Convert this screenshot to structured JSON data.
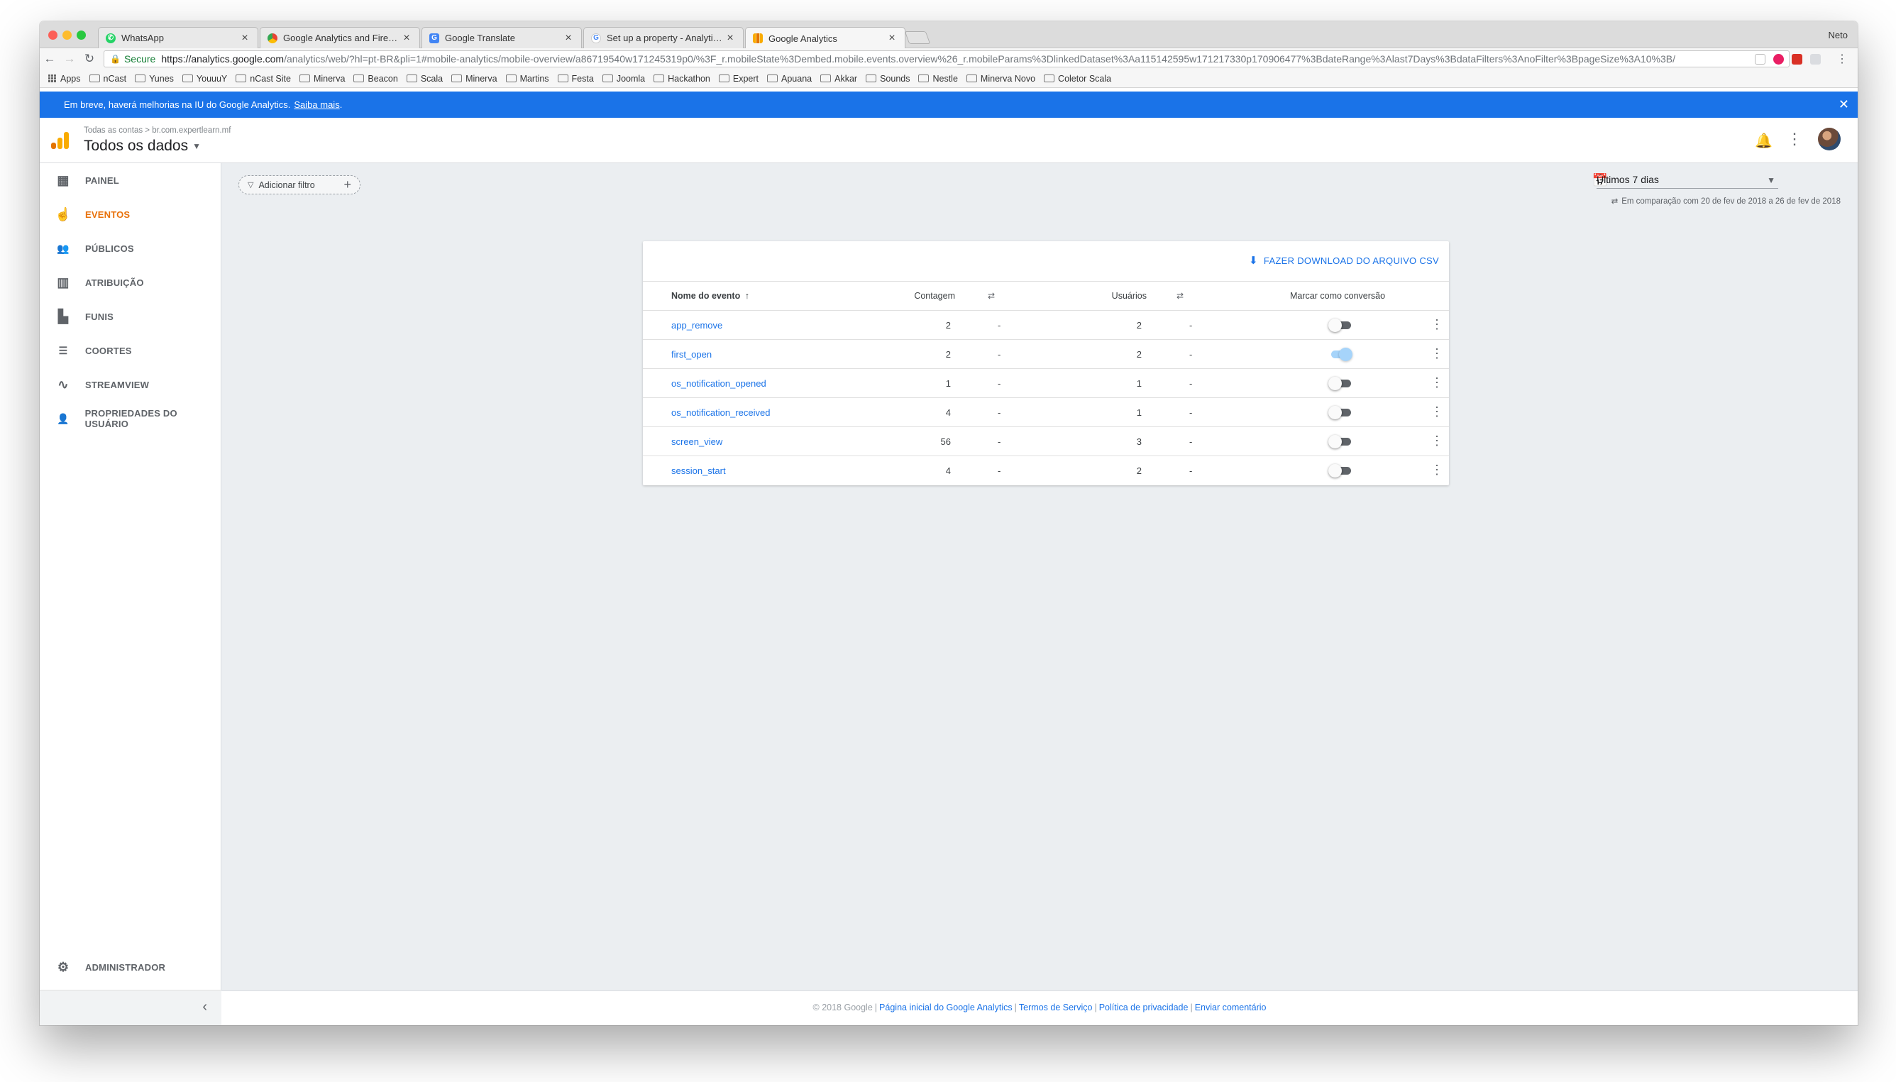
{
  "browser": {
    "profile_name": "Neto",
    "tabs": [
      {
        "label": "WhatsApp",
        "icon": "whatsapp-icon",
        "color": "#25d366"
      },
      {
        "label": "Google Analytics and Firebase",
        "icon": "chrome-icon",
        "color": "#4285f4"
      },
      {
        "label": "Google Translate",
        "icon": "translate-icon",
        "color": "#4285f4"
      },
      {
        "label": "Set up a property - Analytics H",
        "icon": "google-icon",
        "color": "#ea4335"
      },
      {
        "label": "Google Analytics",
        "icon": "analytics-icon",
        "color": "#f9ab00"
      }
    ],
    "secure_label": "Secure",
    "url_host": "https://analytics.google.com",
    "url_path": "/analytics/web/?hl=pt-BR&pli=1#mobile-analytics/mobile-overview/a86719540w171245319p0/%3F_r.mobileState%3Dembed.mobile.events.overview%26_r.mobileParams%3DlinkedDataset%3Aa115142595w171217330p170906477%3BdateRange%3Alast7Days%3BdataFilters%3AnoFilter%3BpageSize%3A10%3B/",
    "bookmarks": [
      "Apps",
      "nCast",
      "Yunes",
      "YouuuY",
      "nCast Site",
      "Minerva",
      "Beacon",
      "Scala",
      "Minerva",
      "Martins",
      "Festa",
      "Joomla",
      "Hackathon",
      "Expert",
      "Apuana",
      "Akkar",
      "Sounds",
      "Nestle",
      "Minerva Novo",
      "Coletor Scala"
    ]
  },
  "banner": {
    "text": "Em breve, haverá melhorias na IU do Google Analytics.",
    "link": "Saiba mais",
    "period": "."
  },
  "header": {
    "breadcrumb": "Todas as contas  >  br.com.expertlearn.mf",
    "title": "Todos os dados"
  },
  "sidebar": {
    "items": [
      {
        "label": "PAINEL",
        "icon": "dashboard-icon"
      },
      {
        "label": "EVENTOS",
        "icon": "touch-icon",
        "active": true
      },
      {
        "label": "PÚBLICOS",
        "icon": "audiences-icon"
      },
      {
        "label": "ATRIBUIÇÃO",
        "icon": "attribution-icon"
      },
      {
        "label": "FUNIS",
        "icon": "funnels-icon"
      },
      {
        "label": "COORTES",
        "icon": "cohorts-icon"
      },
      {
        "label": "STREAMVIEW",
        "icon": "streamview-icon"
      },
      {
        "label": "PROPRIEDADES DO USUÁRIO",
        "icon": "user-properties-icon"
      }
    ],
    "admin_label": "ADMINISTRADOR"
  },
  "main": {
    "filter_label": "Adicionar filtro",
    "date_range": "Últimos 7 dias",
    "comparison": "Em comparação com 20 de fev de 2018 a 26 de fev de 2018"
  },
  "events": {
    "download_label": "FAZER DOWNLOAD DO ARQUIVO CSV",
    "columns": {
      "name": "Nome do evento",
      "count": "Contagem",
      "users": "Usuários",
      "conversion": "Marcar como conversão"
    },
    "rows": [
      {
        "name": "app_remove",
        "count": "2",
        "count_change": "-",
        "users": "2",
        "users_change": "-",
        "conversion": false
      },
      {
        "name": "first_open",
        "count": "2",
        "count_change": "-",
        "users": "2",
        "users_change": "-",
        "conversion": true
      },
      {
        "name": "os_notification_opened",
        "count": "1",
        "count_change": "-",
        "users": "1",
        "users_change": "-",
        "conversion": false
      },
      {
        "name": "os_notification_received",
        "count": "4",
        "count_change": "-",
        "users": "1",
        "users_change": "-",
        "conversion": false
      },
      {
        "name": "screen_view",
        "count": "56",
        "count_change": "-",
        "users": "3",
        "users_change": "-",
        "conversion": false
      },
      {
        "name": "session_start",
        "count": "4",
        "count_change": "-",
        "users": "2",
        "users_change": "-",
        "conversion": false
      }
    ]
  },
  "footer": {
    "copyright": "© 2018 Google",
    "links": [
      "Página inicial do Google Analytics",
      "Termos de Serviço",
      "Política de privacidade",
      "Enviar comentário"
    ]
  }
}
